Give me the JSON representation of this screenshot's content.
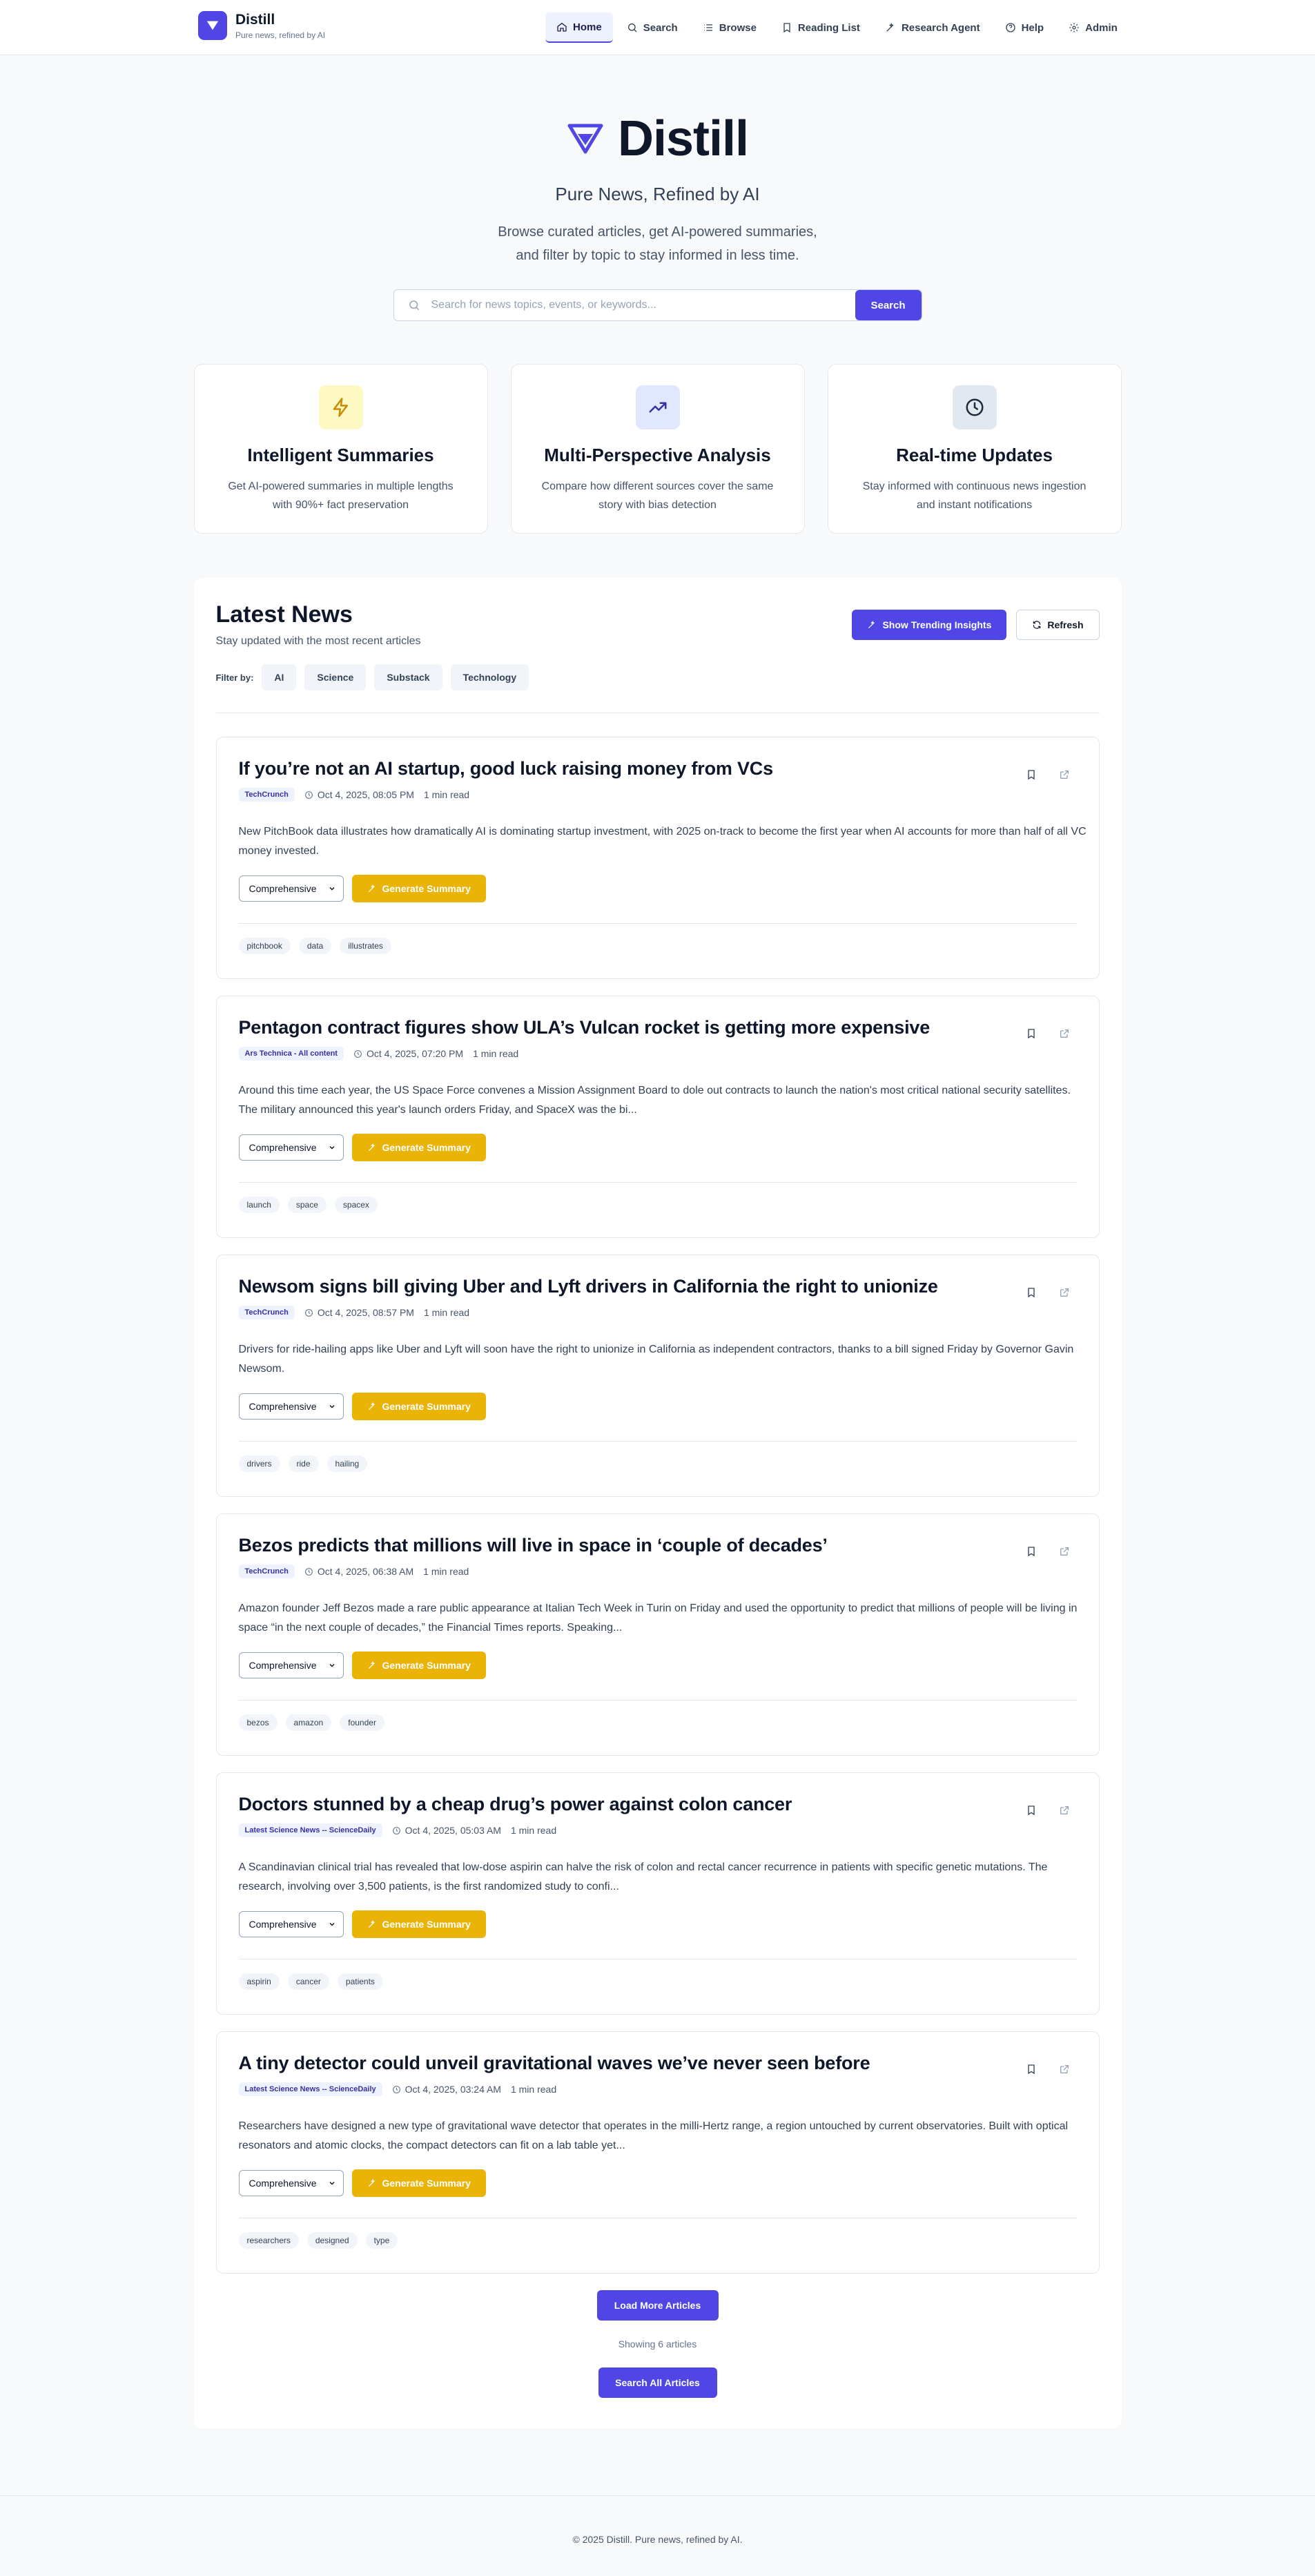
{
  "brand": {
    "name": "Distill",
    "tagline": "Pure news, refined by AI"
  },
  "nav": [
    {
      "label": "Home",
      "icon": "home-icon",
      "active": true
    },
    {
      "label": "Search",
      "icon": "search-icon"
    },
    {
      "label": "Browse",
      "icon": "list-icon"
    },
    {
      "label": "Reading List",
      "icon": "bookmark-icon"
    },
    {
      "label": "Research Agent",
      "icon": "wand-icon"
    },
    {
      "label": "Help",
      "icon": "help-circle-icon"
    },
    {
      "label": "Admin",
      "icon": "gear-icon"
    }
  ],
  "hero": {
    "title": "Distill",
    "subtitle": "Pure News, Refined by AI",
    "desc_line1": "Browse curated articles, get AI-powered summaries,",
    "desc_line2": "and filter by topic to stay informed in less time.",
    "search_placeholder": "Search for news topics, events, or keywords...",
    "search_button": "Search"
  },
  "features": [
    {
      "title": "Intelligent Summaries",
      "desc": "Get AI-powered summaries in multiple lengths with 90%+ fact preservation",
      "icon": "lightning-icon",
      "bg": "#fef9c3"
    },
    {
      "title": "Multi-Perspective Analysis",
      "desc": "Compare how different sources cover the same story with bias detection",
      "icon": "trending-up-icon",
      "bg": "#e0e7ff"
    },
    {
      "title": "Real-time Updates",
      "desc": "Stay informed with continuous news ingestion and instant notifications",
      "icon": "clock-icon",
      "bg": "#e2e8f0"
    }
  ],
  "latest": {
    "title": "Latest News",
    "subtitle": "Stay updated with the most recent articles",
    "trending_button": "Show Trending Insights",
    "refresh_button": "Refresh",
    "filter_label": "Filter by:",
    "filters": [
      "AI",
      "Science",
      "Substack",
      "Technology"
    ]
  },
  "articles": [
    {
      "title": "If you’re not an AI startup, good luck raising money from VCs",
      "source": "TechCrunch",
      "date": "Oct 4, 2025, 08:05 PM",
      "read": "1 min read",
      "desc": "New PitchBook data illustrates how dramatically AI is dominating startup investment, with 2025 on-track to become the first year when AI accounts for more than half of all VC money invested.",
      "length": "Comprehensive",
      "button": "Generate Summary",
      "tags": [
        "pitchbook",
        "data",
        "illustrates"
      ]
    },
    {
      "title": "Pentagon contract figures show ULA’s Vulcan rocket is getting more expensive",
      "source": "Ars Technica - All content",
      "date": "Oct 4, 2025, 07:20 PM",
      "read": "1 min read",
      "desc": "Around this time each year, the US Space Force convenes a Mission Assignment Board to dole out contracts to launch the nation's most critical national security satellites. The military announced this year's launch orders Friday, and SpaceX was the bi...",
      "length": "Comprehensive",
      "button": "Generate Summary",
      "tags": [
        "launch",
        "space",
        "spacex"
      ]
    },
    {
      "title": "Newsom signs bill giving Uber and Lyft drivers in California the right to unionize",
      "source": "TechCrunch",
      "date": "Oct 4, 2025, 08:57 PM",
      "read": "1 min read",
      "desc": "Drivers for ride-hailing apps like Uber and Lyft will soon have the right to unionize in California as independent contractors, thanks to a bill signed Friday by Governor Gavin Newsom.",
      "length": "Comprehensive",
      "button": "Generate Summary",
      "tags": [
        "drivers",
        "ride",
        "hailing"
      ]
    },
    {
      "title": "Bezos predicts that millions will live in space in ‘couple of decades’",
      "source": "TechCrunch",
      "date": "Oct 4, 2025, 06:38 AM",
      "read": "1 min read",
      "desc": "Amazon founder Jeff Bezos made a rare public appearance at Italian Tech Week in Turin on Friday and used the opportunity to predict that millions of people will be living in space “in the next couple of decades,” the Financial Times reports. Speaking...",
      "length": "Comprehensive",
      "button": "Generate Summary",
      "tags": [
        "bezos",
        "amazon",
        "founder"
      ]
    },
    {
      "title": "Doctors stunned by a cheap drug’s power against colon cancer",
      "source": "Latest Science News -- ScienceDaily",
      "date": "Oct 4, 2025, 05:03 AM",
      "read": "1 min read",
      "desc": "A Scandinavian clinical trial has revealed that low-dose aspirin can halve the risk of colon and rectal cancer recurrence in patients with specific genetic mutations. The research, involving over 3,500 patients, is the first randomized study to confi...",
      "length": "Comprehensive",
      "button": "Generate Summary",
      "tags": [
        "aspirin",
        "cancer",
        "patients"
      ]
    },
    {
      "title": "A tiny detector could unveil gravitational waves we’ve never seen before",
      "source": "Latest Science News -- ScienceDaily",
      "date": "Oct 4, 2025, 03:24 AM",
      "read": "1 min read",
      "desc": "Researchers have designed a new type of gravitational wave detector that operates in the milli-Hertz range, a region untouched by current observatories. Built with optical resonators and atomic clocks, the compact detectors can fit on a lab table yet...",
      "length": "Comprehensive",
      "button": "Generate Summary",
      "tags": [
        "researchers",
        "designed",
        "type"
      ]
    }
  ],
  "load_more": "Load More Articles",
  "showing": "Showing 6 articles",
  "search_all": "Search All Articles",
  "footer": "© 2025 Distill. Pure news, refined by AI.",
  "colors": {
    "accent": "#4f46e5",
    "summary": "#eab308"
  }
}
